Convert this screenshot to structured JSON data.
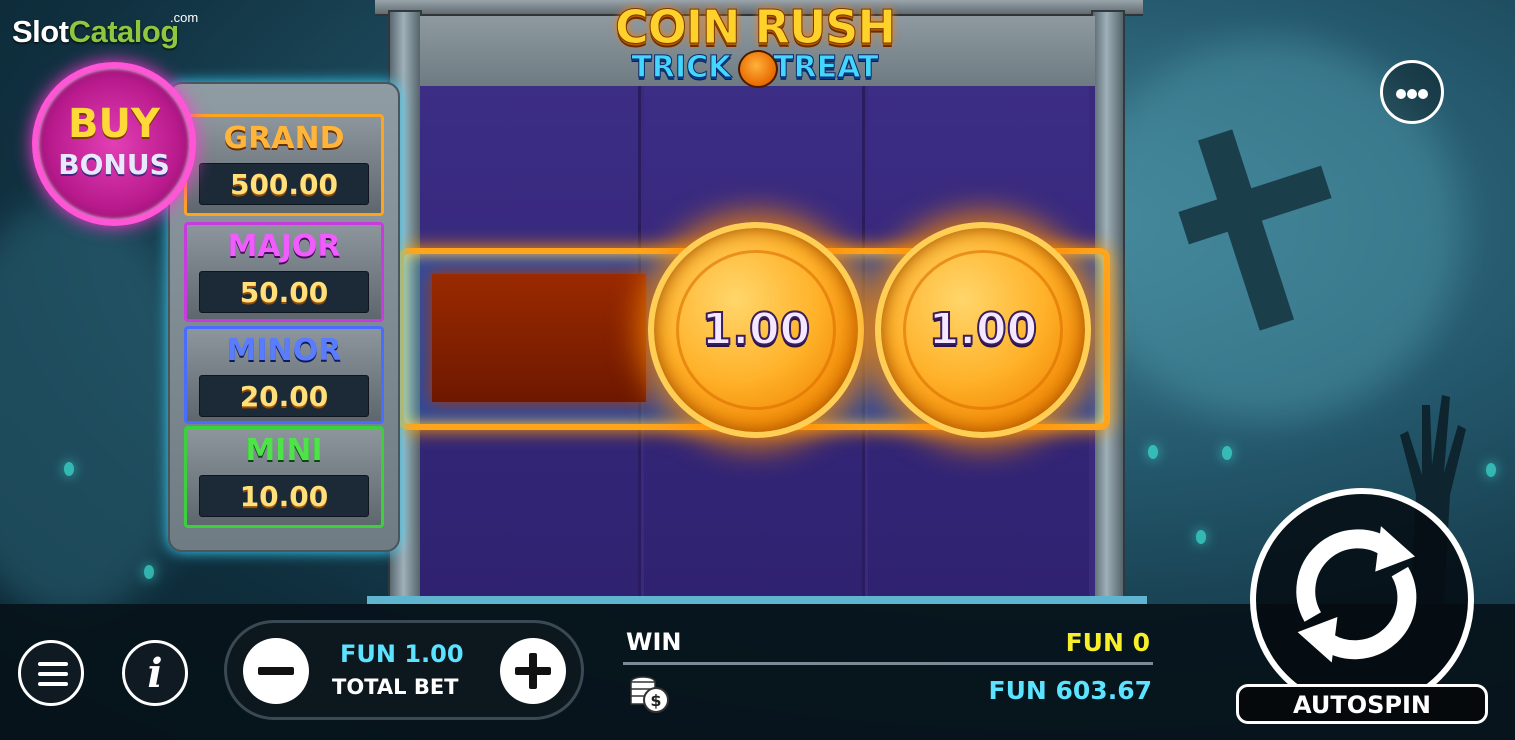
{
  "watermark": {
    "brand_a": "Slot",
    "brand_b": "Catalog",
    "suffix": ".com"
  },
  "game_title": {
    "line1": "COIN RUSH",
    "line2_a": "TRICK",
    "line2_b": "TREAT"
  },
  "buy_bonus": {
    "line1": "BUY",
    "line2": "BONUS"
  },
  "jackpots": [
    {
      "name": "GRAND",
      "value": "500.00",
      "color": "#ffb43a"
    },
    {
      "name": "MAJOR",
      "value": "50.00",
      "color": "#f05cff"
    },
    {
      "name": "MINOR",
      "value": "20.00",
      "color": "#5a7dff"
    },
    {
      "name": "MINI",
      "value": "10.00",
      "color": "#4fe34a"
    }
  ],
  "reels": {
    "coins": [
      {
        "value": "1.00"
      },
      {
        "value": "1.00"
      }
    ]
  },
  "bottom_bar": {
    "bet_amount": "FUN 1.00",
    "bet_label": "TOTAL BET",
    "win_label": "WIN",
    "win_amount": "FUN 0",
    "balance": "FUN 603.67",
    "autospin_label": "AUTOSPIN"
  },
  "icons": {
    "menu": "hamburger-icon",
    "info": "info-icon",
    "more": "more-dots-icon",
    "minus": "minus-icon",
    "plus": "plus-icon",
    "coins": "coin-stack-icon",
    "spin": "spin-arrows-icon"
  },
  "colors": {
    "accent_cyan": "#5ce3ff",
    "win_yellow": "#f7ef2a",
    "reel_purple": "#3a2a7e",
    "frame_orange": "#ffa51c"
  }
}
